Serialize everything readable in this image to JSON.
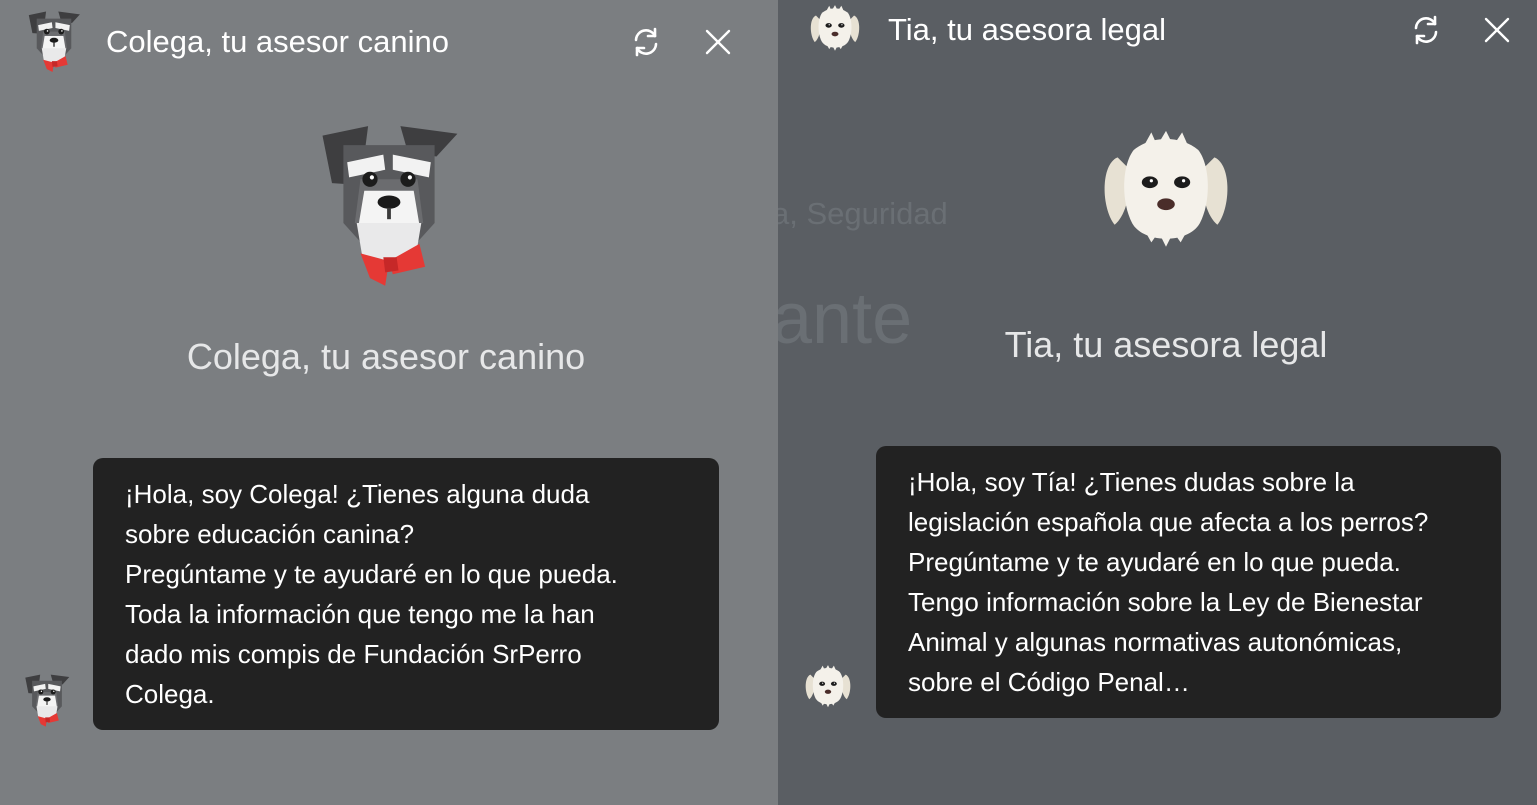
{
  "left_panel": {
    "header_title": "Colega, tu asesor canino",
    "hero_title": "Colega, tu asesor canino",
    "message": "¡Hola, soy Colega! ¿Tienes alguna duda\nsobre educación canina?\nPregúntame y te ayudaré en lo que pueda.\nToda la información que tengo me la han\ndado mis compis de Fundación SrPerro\nColega.",
    "avatar_icon": "schnauzer-dog-icon",
    "colors": {
      "background": "#7b7e81",
      "bubble": "#222222",
      "bowtie": "#e53935"
    }
  },
  "right_panel": {
    "header_title": "Tia, tu asesora legal",
    "hero_title": "Tia, tu asesora legal",
    "background_text_1": "a, Seguridad",
    "background_text_2": "ante",
    "message": "¡Hola, soy Tía! ¿Tienes dudas sobre la\nlegislación española que afecta a los perros?\nPregúntame y te ayudaré en lo que pueda.\nTengo información sobre la Ley de Bienestar\nAnimal y algunas normativas autonómicas,\nsobre el Código Penal…",
    "avatar_icon": "white-fluffy-dog-icon",
    "colors": {
      "background": "#5a5e63",
      "bubble": "#222222"
    }
  },
  "icons": {
    "refresh": "refresh-icon",
    "close": "close-icon"
  }
}
